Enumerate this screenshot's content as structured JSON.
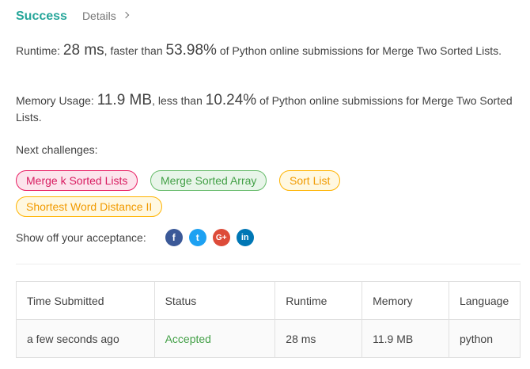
{
  "header": {
    "status": "Success",
    "details_label": "Details"
  },
  "runtime": {
    "label": "Runtime: ",
    "value": "28 ms",
    "faster_text": ", faster than ",
    "percent": "53.98%",
    "tail": " of Python online submissions for Merge Two Sorted Lists."
  },
  "memory": {
    "label": "Memory Usage: ",
    "value": "11.9 MB",
    "less_text": ", less than ",
    "percent": "10.24%",
    "tail": " of Python online submissions for Merge Two Sorted Lists."
  },
  "next_challenges": {
    "label": "Next challenges:",
    "items": [
      {
        "title": "Merge k Sorted Lists",
        "difficulty": "hard"
      },
      {
        "title": "Merge Sorted Array",
        "difficulty": "easy"
      },
      {
        "title": "Sort List",
        "difficulty": "medium"
      },
      {
        "title": "Shortest Word Distance II",
        "difficulty": "medium"
      }
    ]
  },
  "share": {
    "label": "Show off your acceptance:",
    "icons": [
      "facebook-icon",
      "twitter-icon",
      "google-plus-icon",
      "linkedin-icon"
    ],
    "glyphs": {
      "facebook": "f",
      "twitter": "t",
      "google_plus": "G+",
      "linkedin": "in"
    }
  },
  "table": {
    "headers": [
      "Time Submitted",
      "Status",
      "Runtime",
      "Memory",
      "Language"
    ],
    "rows": [
      {
        "time": "a few seconds ago",
        "status": "Accepted",
        "runtime": "28 ms",
        "memory": "11.9 MB",
        "language": "python"
      }
    ]
  },
  "colors": {
    "success": "#26a69a",
    "hard": "#e91e63",
    "easy": "#43a047",
    "medium": "#ffb300",
    "accepted": "#43a047"
  }
}
